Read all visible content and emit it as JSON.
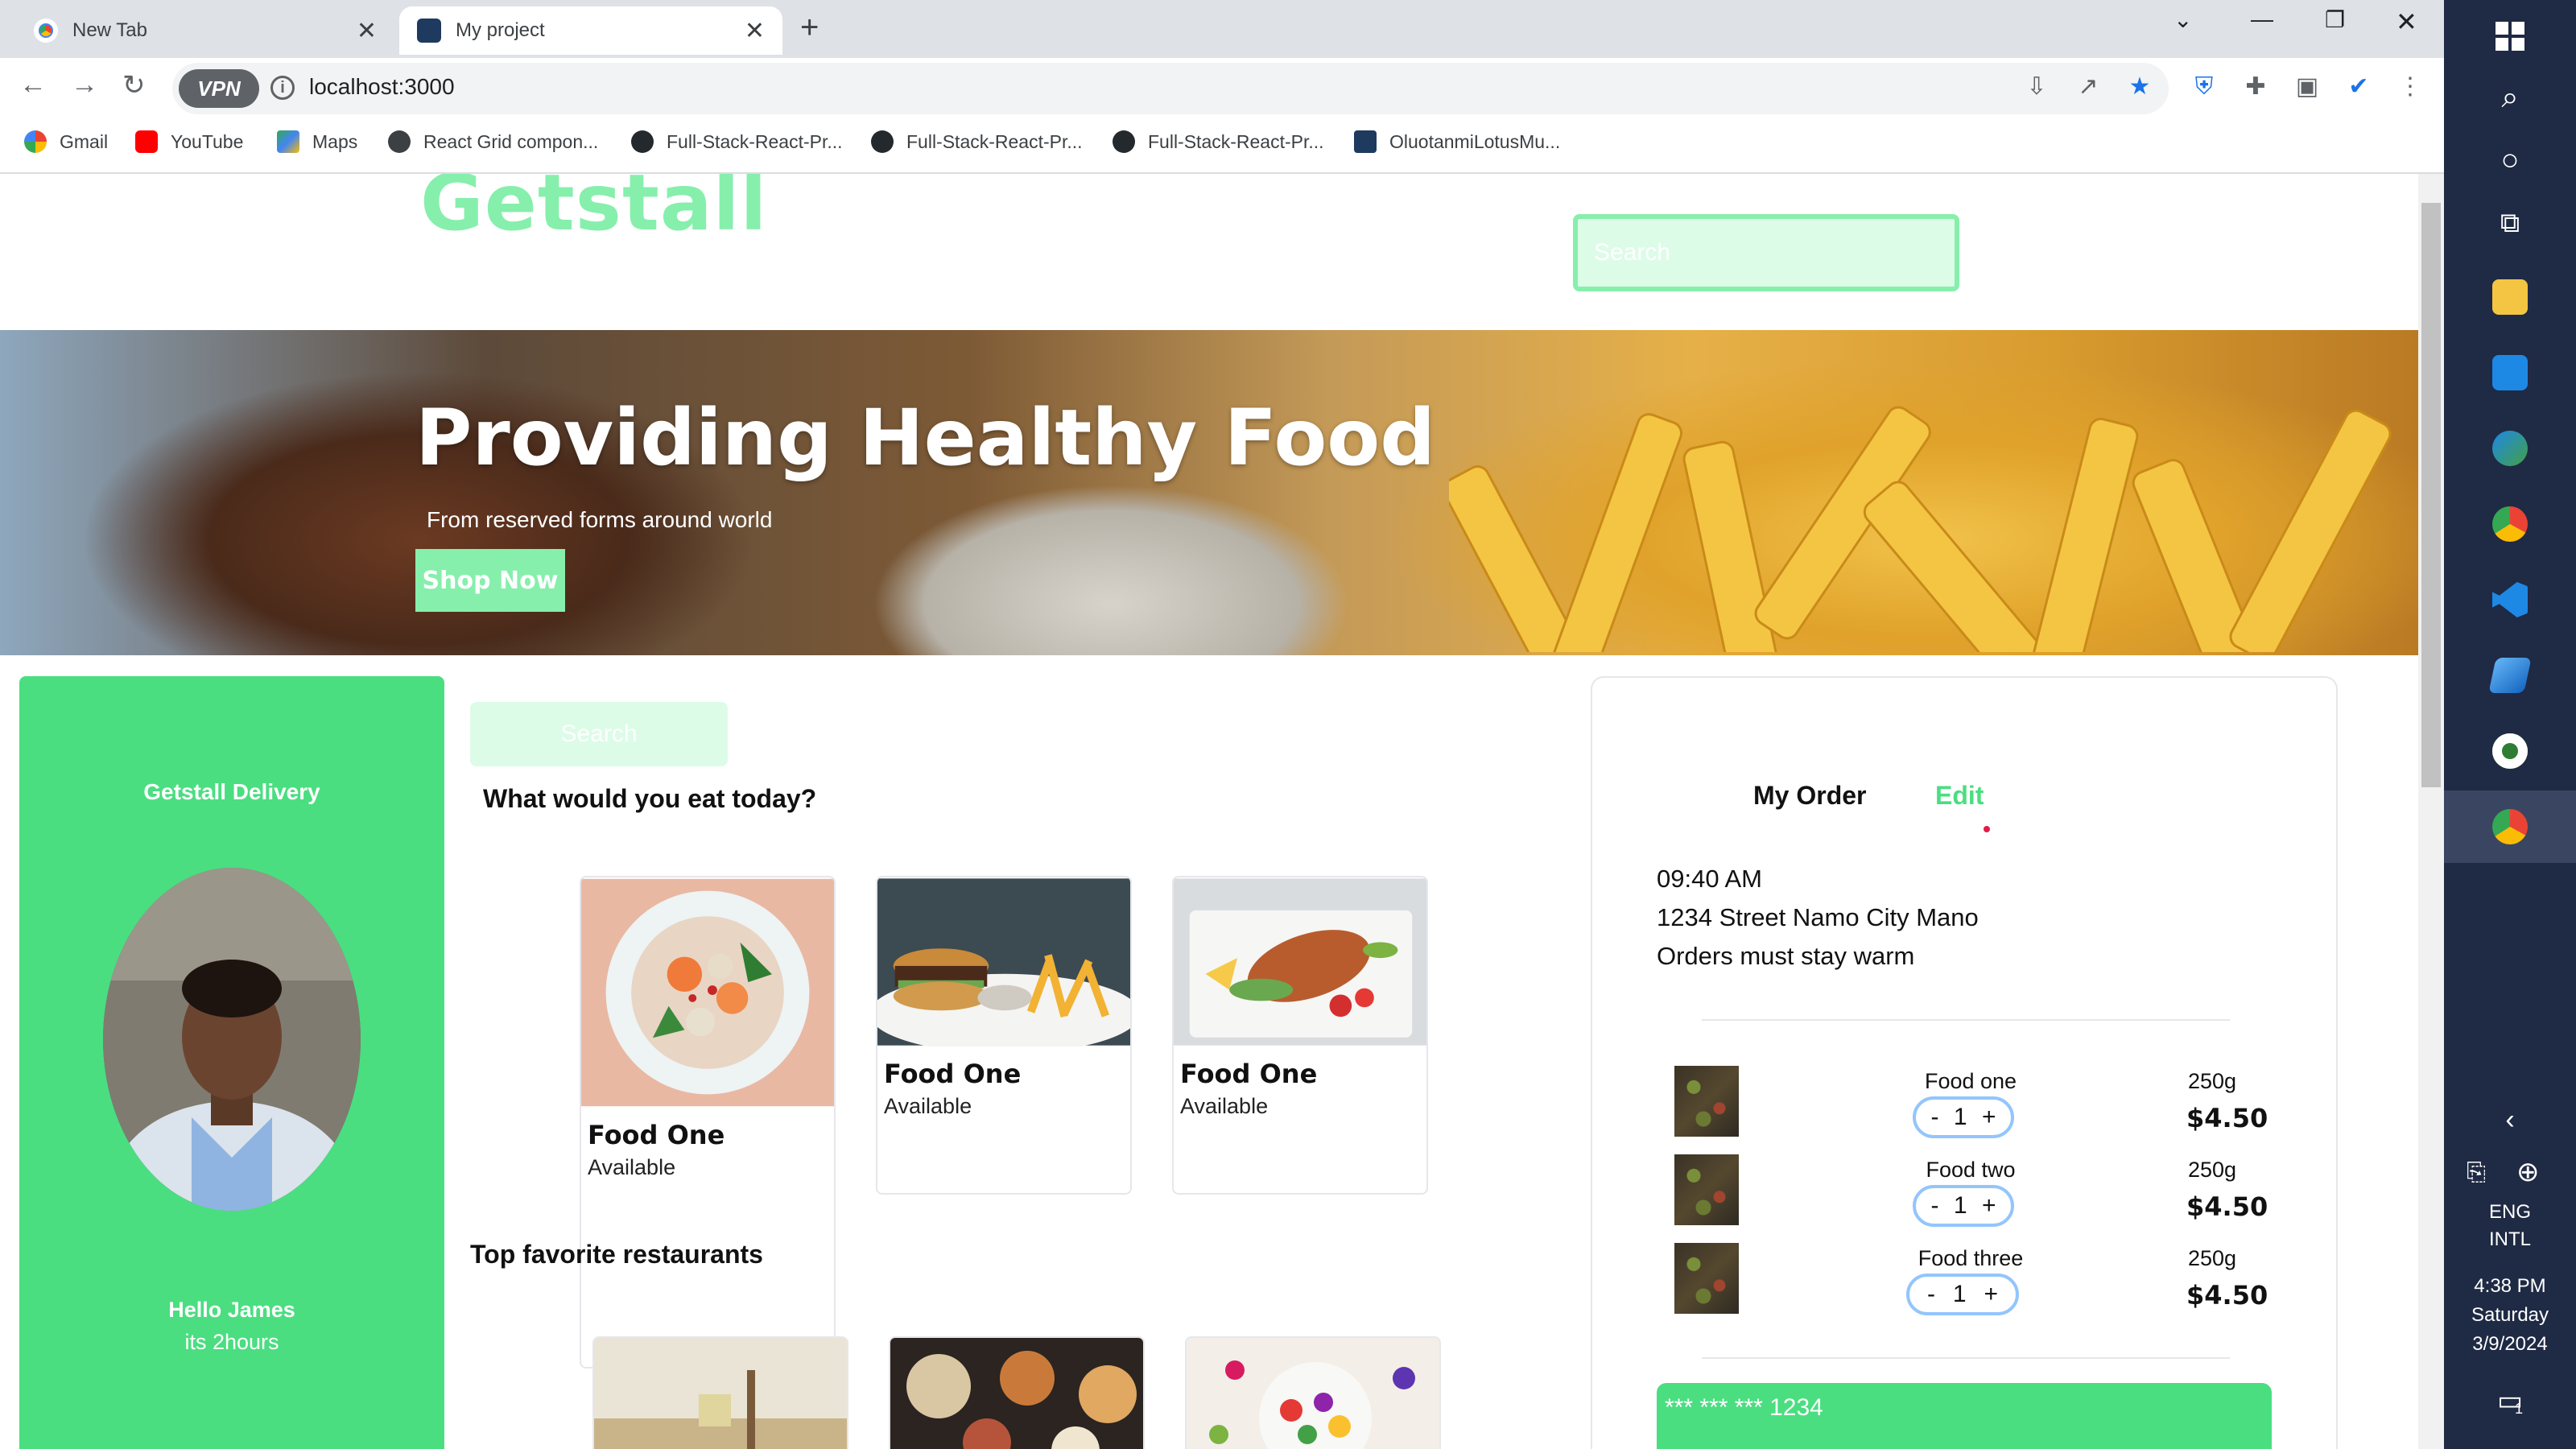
{
  "browser": {
    "tabs": [
      {
        "label": "New Tab",
        "active": false
      },
      {
        "label": "My project",
        "active": true
      }
    ],
    "new_tab_symbol": "+",
    "url": "localhost:3000",
    "vpn_label": "VPN",
    "bookmarks": [
      {
        "label": "Gmail",
        "icon": "gmail-icon",
        "color": "#ea4335"
      },
      {
        "label": "YouTube",
        "icon": "youtube-icon",
        "color": "#ff0000"
      },
      {
        "label": "Maps",
        "icon": "maps-icon",
        "color": "#34a853"
      },
      {
        "label": "React Grid compon...",
        "icon": "globe-icon",
        "color": "#3c4043"
      },
      {
        "label": "Full-Stack-React-Pr...",
        "icon": "github-icon",
        "color": "#24292e"
      },
      {
        "label": "Full-Stack-React-Pr...",
        "icon": "github-icon",
        "color": "#24292e"
      },
      {
        "label": "Full-Stack-React-Pr...",
        "icon": "github-icon",
        "color": "#24292e"
      },
      {
        "label": "OluotanmiLotusMu...",
        "icon": "react-icon",
        "color": "#1e3a5f"
      }
    ]
  },
  "header": {
    "logo": "Getstall",
    "search_placeholder": "Search"
  },
  "hero": {
    "title": "Providing Healthy Food",
    "subtitle": "From reserved forms around world",
    "cta": "Shop Now"
  },
  "delivery": {
    "title": "Getstall Delivery",
    "greeting": "Hello James",
    "subtext": "its 2hours"
  },
  "main": {
    "search_placeholder": "Search",
    "heading": "What would you eat today?",
    "foods": [
      {
        "name": "Food One",
        "status": "Available"
      },
      {
        "name": "Food One",
        "status": "Available"
      },
      {
        "name": "Food One",
        "status": "Available"
      }
    ],
    "favorites_heading": "Top favorite restaurants"
  },
  "order": {
    "title": "My Order",
    "edit": "Edit",
    "time": "09:40 AM",
    "address": "1234 Street Namo City Mano",
    "note": "Orders must stay warm",
    "items": [
      {
        "name": "Food one",
        "qty": "1",
        "weight": "250g",
        "price": "$4.50"
      },
      {
        "name": "Food two",
        "qty": "1",
        "weight": "250g",
        "price": "$4.50"
      },
      {
        "name": "Food three",
        "qty": "1",
        "weight": "250g",
        "price": "$4.50"
      }
    ],
    "minus": "-",
    "plus": "+",
    "card_number": "*** *** *** 1234"
  },
  "taskbar": {
    "language": "ENG",
    "layout": "INTL",
    "time": "4:38 PM",
    "day": "Saturday",
    "date": "3/9/2024",
    "notification_count": "1"
  },
  "colors": {
    "brand_green": "#4ade80",
    "light_green": "#86efac",
    "pale_green": "#dcfce7"
  }
}
